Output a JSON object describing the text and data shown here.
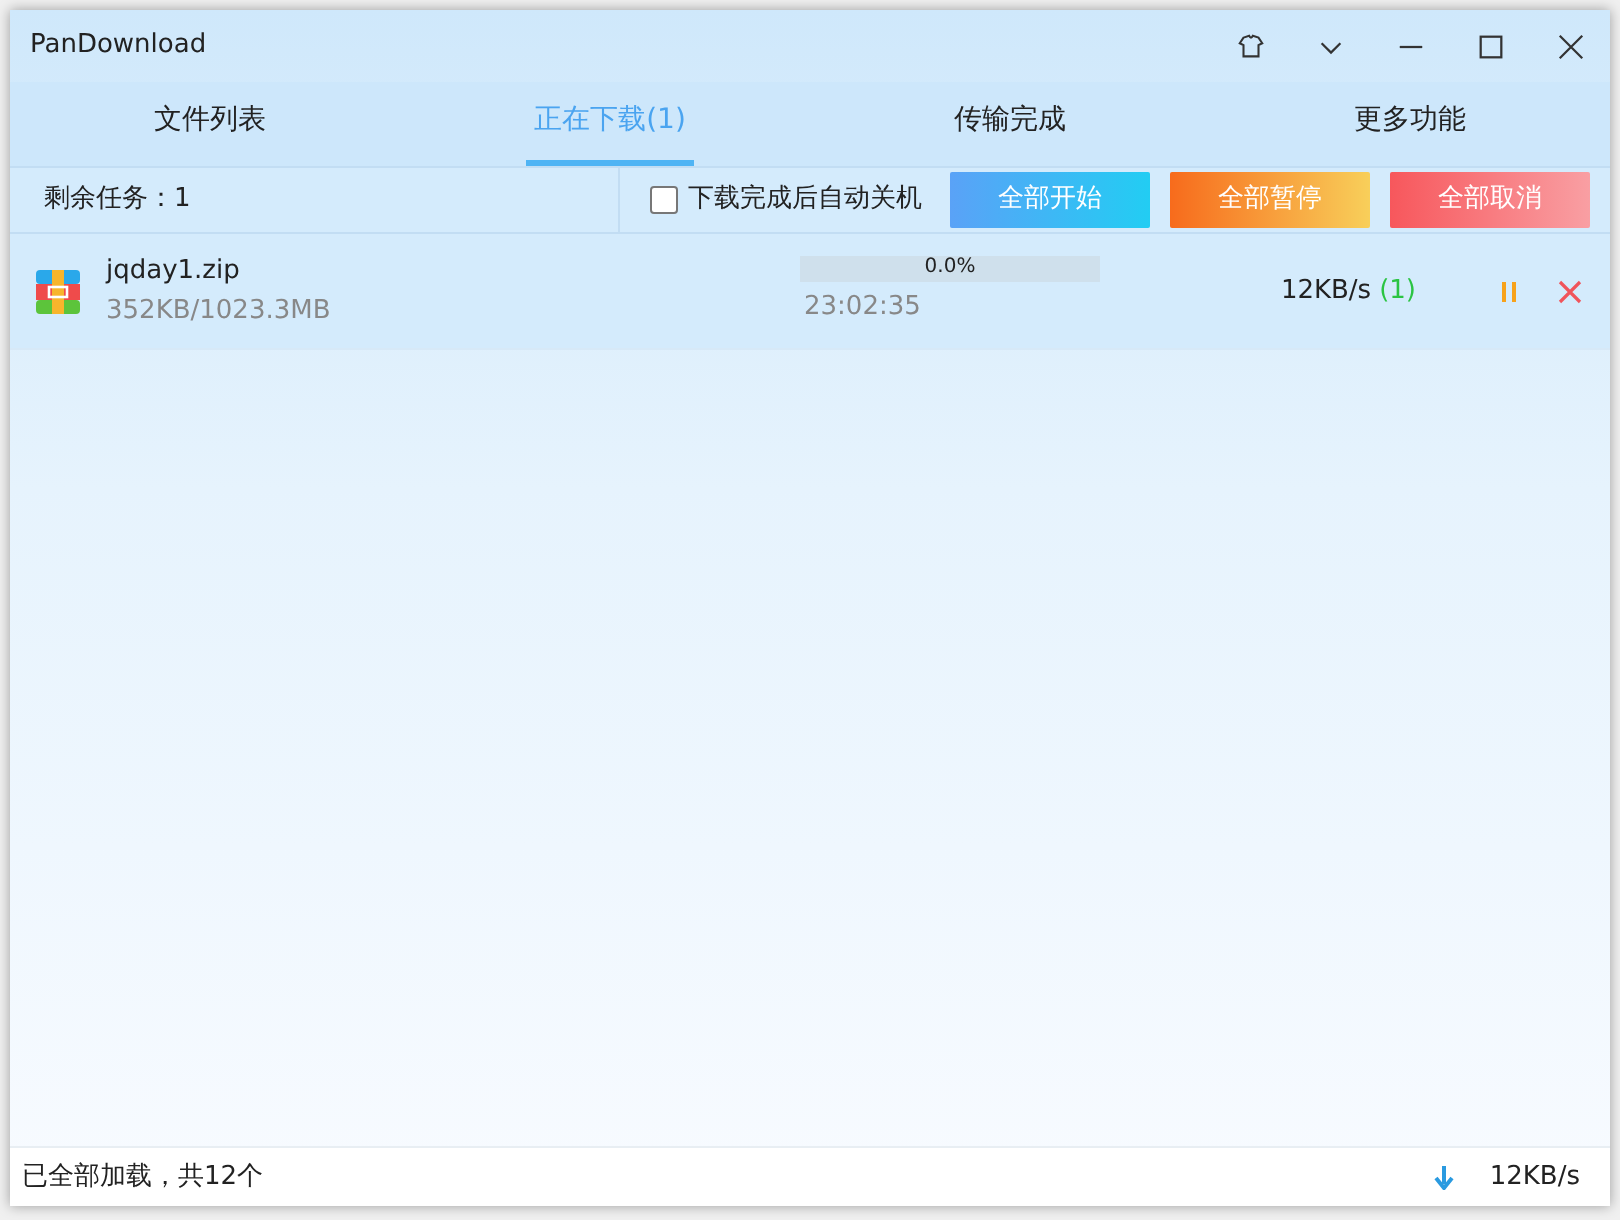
{
  "window": {
    "title": "PanDownload"
  },
  "tabs": [
    {
      "label": "文件列表",
      "selected": false
    },
    {
      "label": "正在下载(1)",
      "selected": true
    },
    {
      "label": "传输完成",
      "selected": false
    },
    {
      "label": "更多功能",
      "selected": false
    }
  ],
  "toolbar": {
    "remaining": "剩余任务：1",
    "shutdown": {
      "label": "下载完成后自动关机",
      "checked": false
    },
    "buttons": [
      {
        "label": "全部开始",
        "kind": "start"
      },
      {
        "label": "全部暂停",
        "kind": "pause"
      },
      {
        "label": "全部取消",
        "kind": "cancel"
      }
    ]
  },
  "downloads": [
    {
      "name": "jqday1.zip",
      "size": "352KB/1023.3MB",
      "level": 0,
      "percent": "0.0%",
      "time": "23:02:35",
      "speed": "12KB/s",
      "connections": "(1)"
    }
  ],
  "status_bar": {
    "text": "已全部加载，共12个",
    "speed": "12KB/s"
  }
}
